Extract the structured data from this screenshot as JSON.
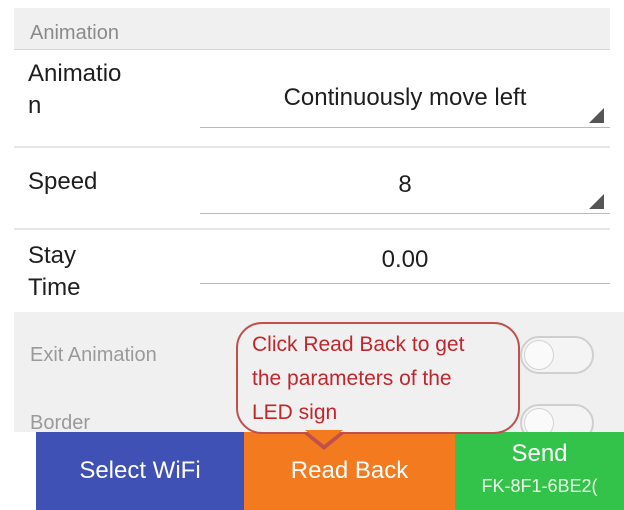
{
  "section": {
    "title": "Animation"
  },
  "rows": {
    "animation": {
      "label": "Animatio\nn",
      "value": "Continuously move left"
    },
    "speed": {
      "label": "Speed",
      "value": "8"
    },
    "stay_time": {
      "label": "Stay\nTime",
      "value": "0.00"
    }
  },
  "toggles": {
    "exit_animation": {
      "label": "Exit Animation",
      "checked": false
    },
    "border": {
      "label": "Border",
      "checked": false
    }
  },
  "callout": {
    "text": "Click Read Back to get\nthe parameters of the\nLED sign"
  },
  "buttons": {
    "select_wifi": "Select WiFi",
    "read_back": "Read Back",
    "send": "Send",
    "send_device": "FK-8F1-6BE2("
  },
  "colors": {
    "select_wifi_bg": "#3f51b5",
    "read_back_bg": "#f37a1f",
    "send_bg": "#33c24a",
    "callout_border": "#c0504d"
  },
  "icons": [
    "spinner-arrow-icon",
    "toggle-switch"
  ]
}
